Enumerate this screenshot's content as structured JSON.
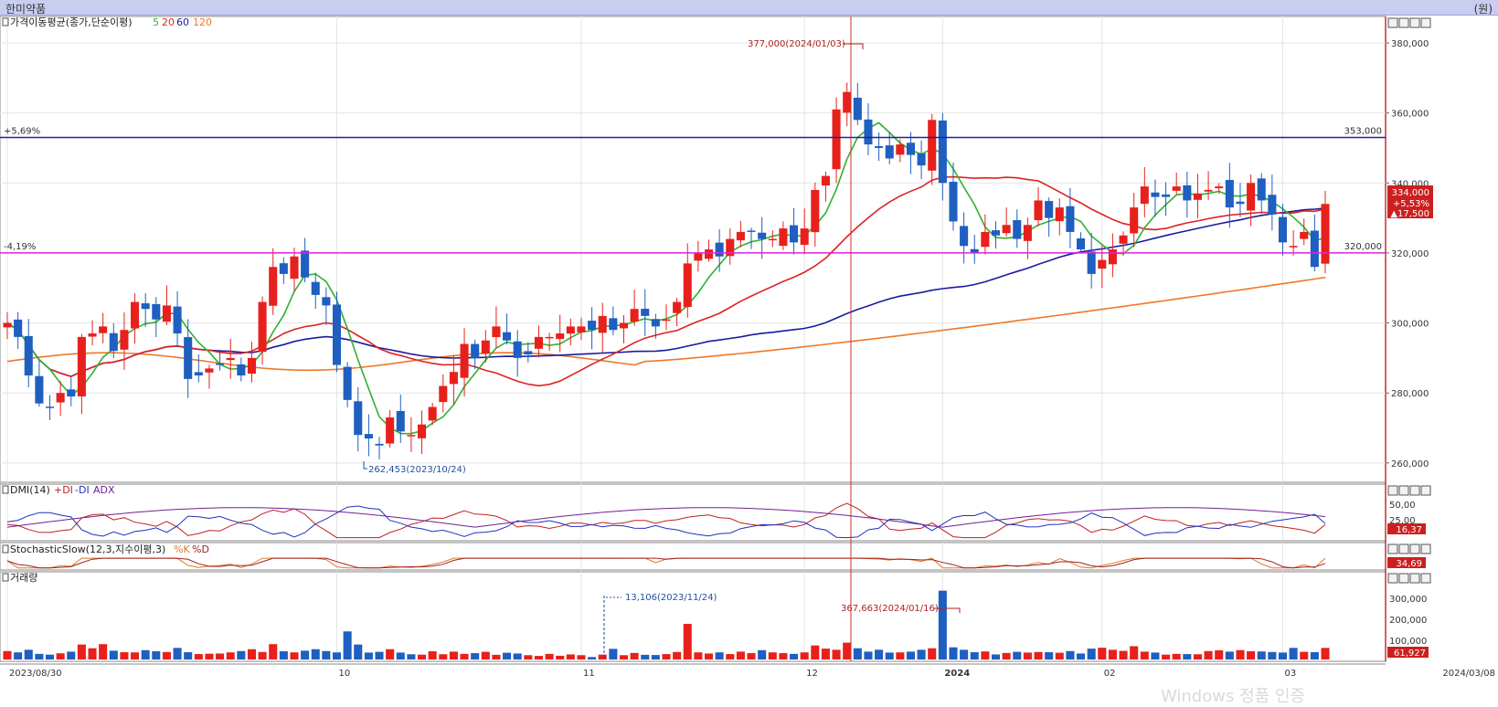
{
  "window": {
    "title": "한미약품",
    "unit": "(원)"
  },
  "panels": {
    "price": {
      "label": "가격이동평균(종가,단순이평)",
      "ma_labels": [
        "5",
        "20",
        "60",
        "120"
      ]
    },
    "dmi": {
      "label": "DMI(14)",
      "series": [
        "+DI",
        "-DI",
        "ADX"
      ],
      "ticks": [
        "50,00",
        "25,00"
      ],
      "current": "16,37"
    },
    "stoch": {
      "label": "StochasticSlow(12,3,지수이평,3)",
      "series": [
        "%K",
        "%D"
      ],
      "current": "34,69"
    },
    "volume": {
      "label": "거래량",
      "ticks": [
        "300,000",
        "200,000",
        "100,000"
      ],
      "current": "61,927"
    }
  },
  "colors": {
    "up": "#e8201c",
    "down": "#1f5fc0",
    "ma5": "#30b030",
    "ma20": "#dd2222",
    "ma60": "#1a1aa0",
    "ma120": "#f07828",
    "hline_blue": "#2020a0",
    "hline_magenta": "#e020e0"
  },
  "chart_data": {
    "type": "candlestick",
    "ylim": [
      255000,
      386000
    ],
    "yticks": [
      "380,000",
      "360,000",
      "340,000",
      "320,000",
      "300,000",
      "280,000",
      "260,000"
    ],
    "x_labels": [
      "2023/08/30",
      "10",
      "11",
      "12",
      "2024",
      "02",
      "03",
      "2024/03/08"
    ],
    "hlines": [
      {
        "value": 353000,
        "left_label": "+5,69%",
        "right_label": "353,000"
      },
      {
        "value": 320000,
        "left_label": "-4,19%",
        "right_label": "320,000"
      }
    ],
    "annotations": {
      "high": "377,000(2024/01/03)",
      "low": "262,453(2023/10/24)",
      "vol_high": "367,663(2024/01/16)",
      "vol_low": "13,106(2023/11/24)"
    },
    "current": {
      "price": "334,000",
      "change_pct": "+5,53%",
      "change": "▲17,500"
    },
    "closes": [
      300000,
      296000,
      285000,
      277000,
      276000,
      280000,
      279000,
      296000,
      297000,
      299000,
      292000,
      298000,
      306000,
      304000,
      301000,
      305000,
      297000,
      284000,
      285000,
      287000,
      288000,
      290000,
      285000,
      290000,
      306000,
      316000,
      314000,
      319000,
      313000,
      308000,
      305000,
      288000,
      278000,
      268000,
      267000,
      265000,
      273000,
      269000,
      268000,
      271000,
      276000,
      282000,
      286000,
      294000,
      290000,
      295000,
      299000,
      295000,
      290000,
      291000,
      296000,
      296000,
      297000,
      299000,
      299000,
      298000,
      302000,
      298000,
      300000,
      304000,
      302000,
      299000,
      301000,
      306000,
      317000,
      320000,
      321000,
      319000,
      324000,
      326000,
      326000,
      324000,
      324000,
      327000,
      323000,
      327000,
      338000,
      342000,
      361000,
      366000,
      358000,
      351000,
      350000,
      347000,
      351000,
      348000,
      345000,
      358000,
      340000,
      329000,
      322000,
      320000,
      326000,
      325000,
      328000,
      324000,
      328000,
      335000,
      330000,
      333000,
      326000,
      321000,
      314000,
      318000,
      321000,
      325000,
      333000,
      339000,
      336000,
      336000,
      339000,
      335000,
      337000,
      338000,
      339000,
      333000,
      334000,
      340000,
      335000,
      331000,
      323000,
      322000,
      326000,
      316000,
      334000
    ],
    "volumes": [
      45000,
      38000,
      52000,
      30000,
      26000,
      33000,
      42000,
      80000,
      60000,
      82000,
      47000,
      39000,
      38000,
      50000,
      44000,
      40000,
      62000,
      39000,
      29000,
      31000,
      32000,
      38000,
      45000,
      55000,
      40000,
      82000,
      44000,
      38000,
      47000,
      55000,
      45000,
      38000,
      150000,
      80000,
      37000,
      41000,
      55000,
      37000,
      28000,
      26000,
      44000,
      28000,
      42000,
      30000,
      34000,
      41000,
      25000,
      36000,
      32000,
      23000,
      19000,
      30000,
      20000,
      27000,
      23000,
      13106,
      26000,
      57000,
      23000,
      35000,
      25000,
      24000,
      29000,
      40000,
      190000,
      38000,
      32000,
      38000,
      29000,
      42000,
      34000,
      50000,
      38000,
      34000,
      30000,
      38000,
      75000,
      58000,
      52000,
      90000,
      60000,
      42000,
      52000,
      37000,
      38000,
      42000,
      52000,
      60000,
      367663,
      65000,
      52000,
      39000,
      43000,
      27000,
      35000,
      41000,
      37000,
      40000,
      39000,
      36000,
      45000,
      32000,
      58000,
      63000,
      52000,
      46000,
      71000,
      42000,
      37000,
      26000,
      30000,
      29000,
      28000,
      45000,
      49000,
      42000,
      50000,
      44000,
      43000,
      40000,
      37000,
      62000,
      41000,
      39000,
      61927
    ]
  }
}
